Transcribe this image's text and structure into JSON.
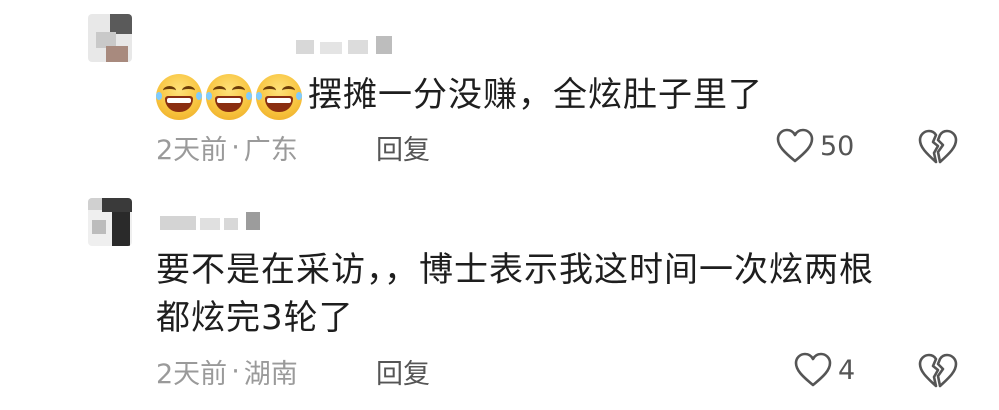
{
  "comments": [
    {
      "text": "摆摊一分没赚，全炫肚子里了",
      "emojis": [
        "laughing-tears-emoji",
        "laughing-tears-emoji",
        "laughing-tears-emoji"
      ],
      "time": "2天前",
      "separator": "·",
      "location": "广东",
      "reply_label": "回复",
      "likes": "50"
    },
    {
      "text_line1": "要不是在采访，，博士表示我这时间一次炫两根",
      "text_line2": "都炫完3轮了",
      "time": "2天前",
      "separator": "·",
      "location": "湖南",
      "reply_label": "回复",
      "likes": "4"
    }
  ],
  "icons": {
    "like": "heart-outline-icon",
    "dislike": "broken-heart-icon"
  },
  "colors": {
    "meta_text": "#9a9a9a",
    "icon_stroke": "#555555"
  }
}
